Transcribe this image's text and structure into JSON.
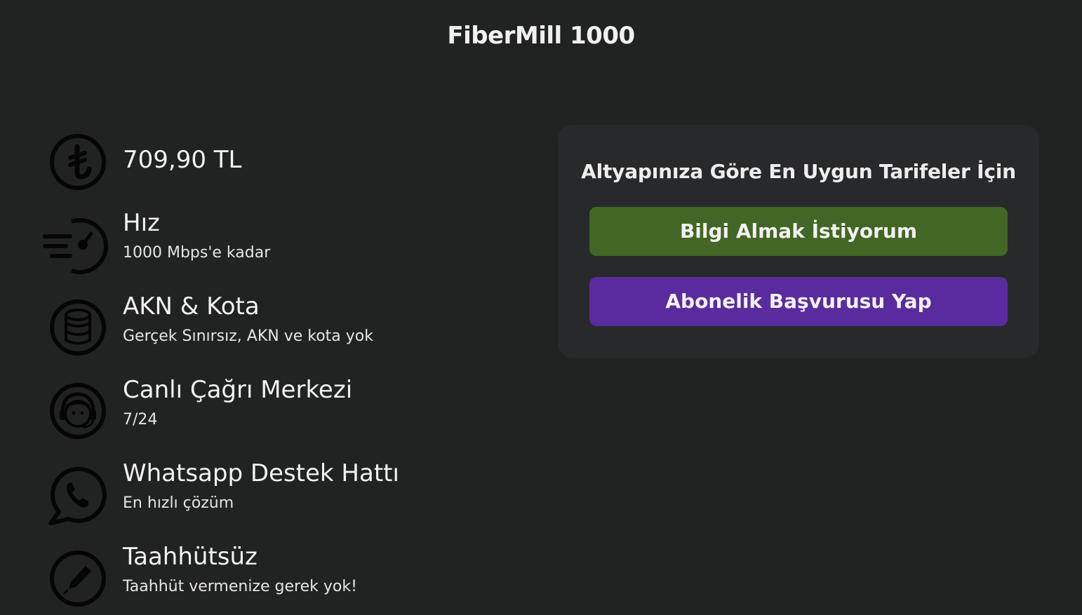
{
  "page": {
    "title": "FiberMill 1000"
  },
  "features": [
    {
      "icon": "lira-coin-icon",
      "title": "709,90 TL",
      "subtitle": ""
    },
    {
      "icon": "speedometer-icon",
      "title": "Hız",
      "subtitle": "1000 Mbps'e kadar"
    },
    {
      "icon": "database-icon",
      "title": "AKN & Kota",
      "subtitle": "Gerçek Sınırsız, AKN ve kota yok"
    },
    {
      "icon": "headset-agent-icon",
      "title": "Canlı Çağrı Merkezi",
      "subtitle": "7/24"
    },
    {
      "icon": "whatsapp-icon",
      "title": "Whatsapp Destek Hattı",
      "subtitle": "En hızlı çözüm"
    },
    {
      "icon": "pen-icon",
      "title": "Taahhütsüz",
      "subtitle": "Taahhüt vermenize gerek yok!"
    }
  ],
  "cta": {
    "title": "Altyapınıza Göre En Uygun Tarifeler İçin",
    "info_button": "Bilgi Almak İstiyorum",
    "subscribe_button": "Abonelik Başvurusu Yap"
  },
  "colors": {
    "background": "#212222",
    "card": "#28292b",
    "info_button": "#426624",
    "subscribe_button": "#5a2b9e",
    "icon": "#050505"
  }
}
